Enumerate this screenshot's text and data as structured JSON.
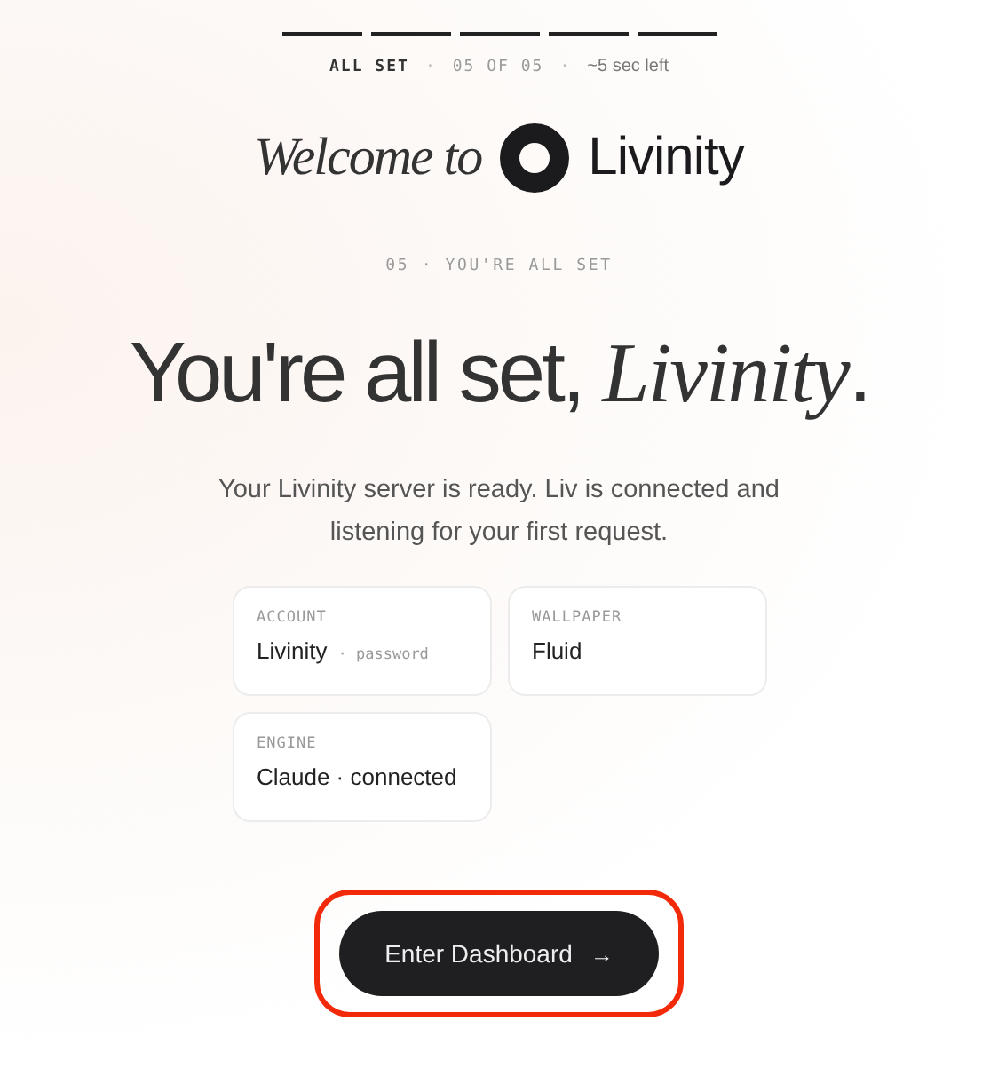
{
  "progress": {
    "steps": [
      {
        "done": true
      },
      {
        "done": true
      },
      {
        "done": true
      },
      {
        "done": true
      },
      {
        "done": true
      }
    ],
    "separator": "·",
    "status": "ALL SET",
    "count": "05 OF 05",
    "eta": "~5 sec left"
  },
  "brand": {
    "welcome": "Welcome to",
    "name": "Livinity"
  },
  "step_label": "05 · YOU'RE ALL SET",
  "headline": "You're all set, *Livinity*.",
  "description": "Your Livinity server is ready. Liv is connected and listening for your first request.",
  "cards": [
    {
      "label": "ACCOUNT",
      "value": "Livinity",
      "note": "· password"
    },
    {
      "label": "WALLPAPER",
      "value": "Fluid"
    },
    {
      "label": "ENGINE",
      "value": "Claude · connected"
    }
  ],
  "button": {
    "label": "Enter Dashboard",
    "icon": "→",
    "highlighted": true
  }
}
